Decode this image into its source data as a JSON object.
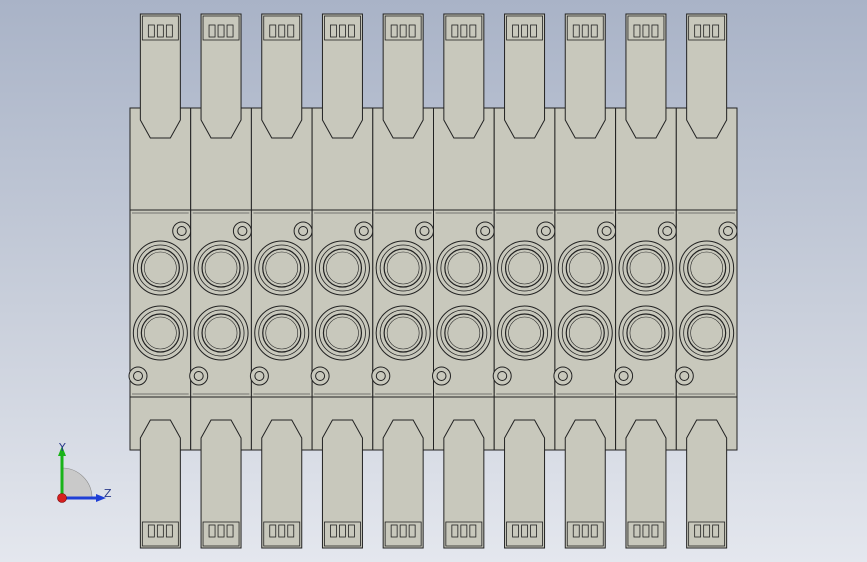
{
  "viewport": {
    "background_top": "#a9b3c7",
    "background_bottom": "#e4e7ee"
  },
  "model": {
    "valve_count": 10,
    "body_color": "#c8c8bc",
    "outline_color": "#222222"
  },
  "triad": {
    "y_label": "Y",
    "z_label": "Z",
    "y_color": "#19b319",
    "z_color": "#1f3fd6",
    "x_color": "#d61f1f"
  }
}
